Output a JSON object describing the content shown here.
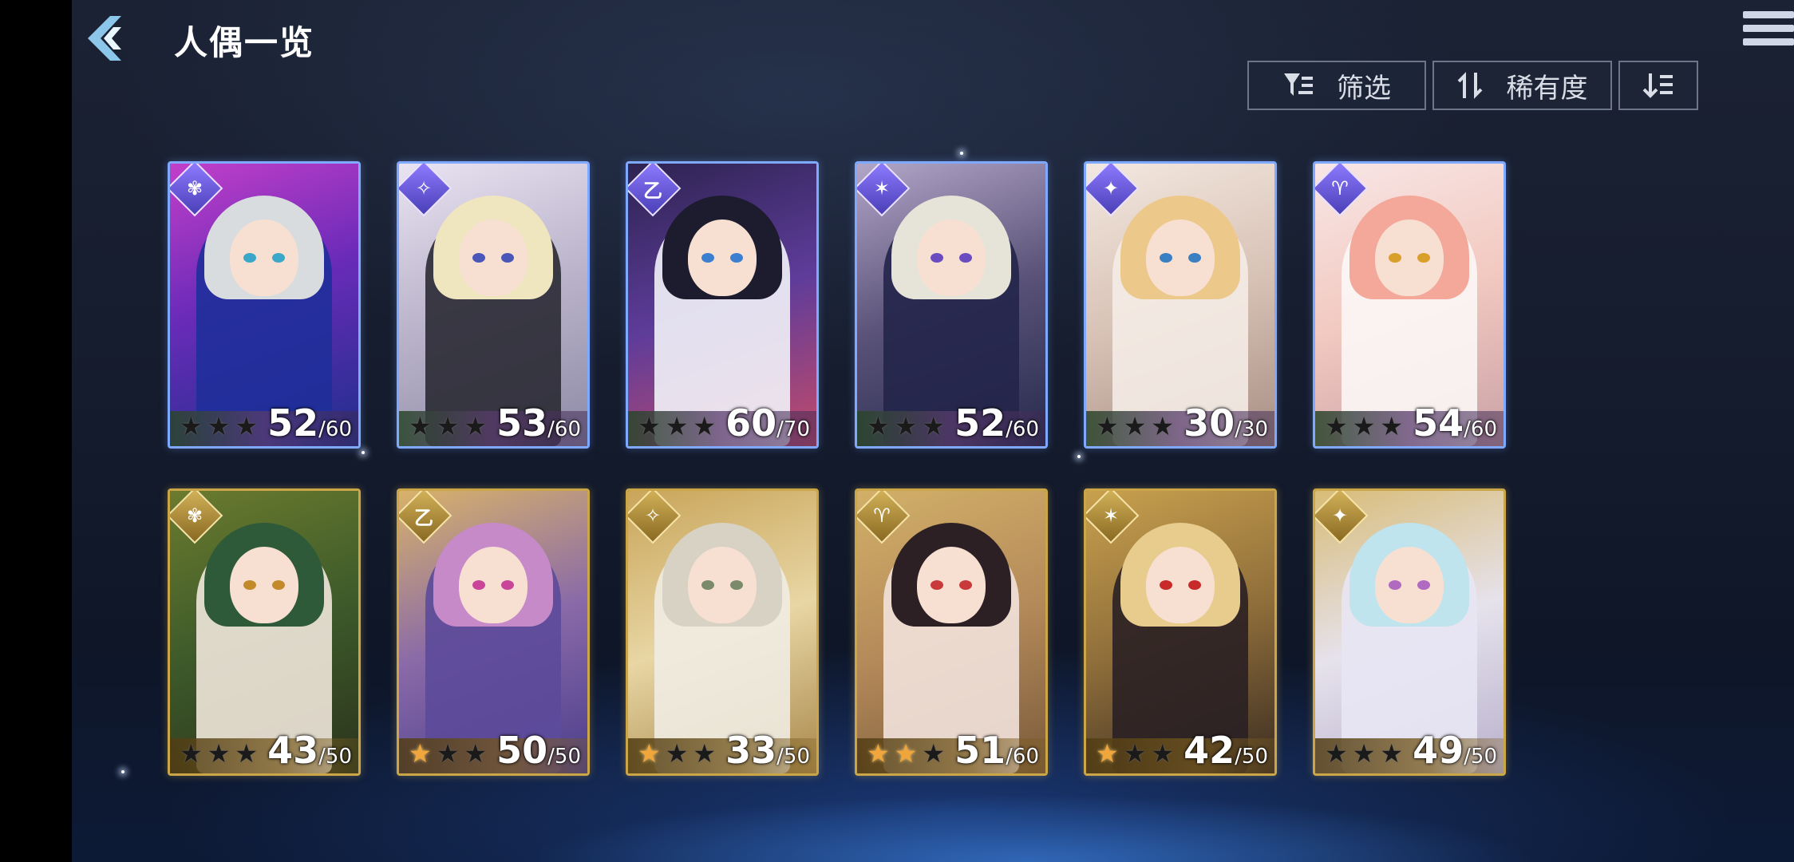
{
  "header": {
    "title": "人偶一览"
  },
  "toolbar": {
    "filter_label": "筛选",
    "sort_label": "稀有度"
  },
  "colors": {
    "rare_frame": "#7fa8ff",
    "gold_frame": "#caa648",
    "star_lit": "#f0a63a",
    "star_dim": "#1a1a1a"
  },
  "cards": [
    {
      "icon": "element-icon",
      "rank": "rare",
      "level": "52",
      "max": "60",
      "stars_lit": 0
    },
    {
      "icon": "element-icon",
      "rank": "rare",
      "level": "53",
      "max": "60",
      "stars_lit": 0
    },
    {
      "icon": "element-icon",
      "rank": "rare",
      "level": "60",
      "max": "70",
      "stars_lit": 0
    },
    {
      "icon": "element-icon",
      "rank": "rare",
      "level": "52",
      "max": "60",
      "stars_lit": 0
    },
    {
      "icon": "element-icon",
      "rank": "rare",
      "level": "30",
      "max": "30",
      "stars_lit": 0
    },
    {
      "icon": "element-icon",
      "rank": "rare",
      "level": "54",
      "max": "60",
      "stars_lit": 0
    },
    {
      "icon": "element-icon",
      "rank": "gold",
      "level": "43",
      "max": "50",
      "stars_lit": 0
    },
    {
      "icon": "element-icon",
      "rank": "gold",
      "level": "50",
      "max": "50",
      "stars_lit": 1
    },
    {
      "icon": "element-icon",
      "rank": "gold",
      "level": "33",
      "max": "50",
      "stars_lit": 1
    },
    {
      "icon": "element-icon",
      "rank": "gold",
      "level": "51",
      "max": "60",
      "stars_lit": 2
    },
    {
      "icon": "element-icon",
      "rank": "gold",
      "level": "42",
      "max": "50",
      "stars_lit": 1
    },
    {
      "icon": "element-icon",
      "rank": "gold",
      "level": "49",
      "max": "50",
      "stars_lit": 0
    }
  ]
}
